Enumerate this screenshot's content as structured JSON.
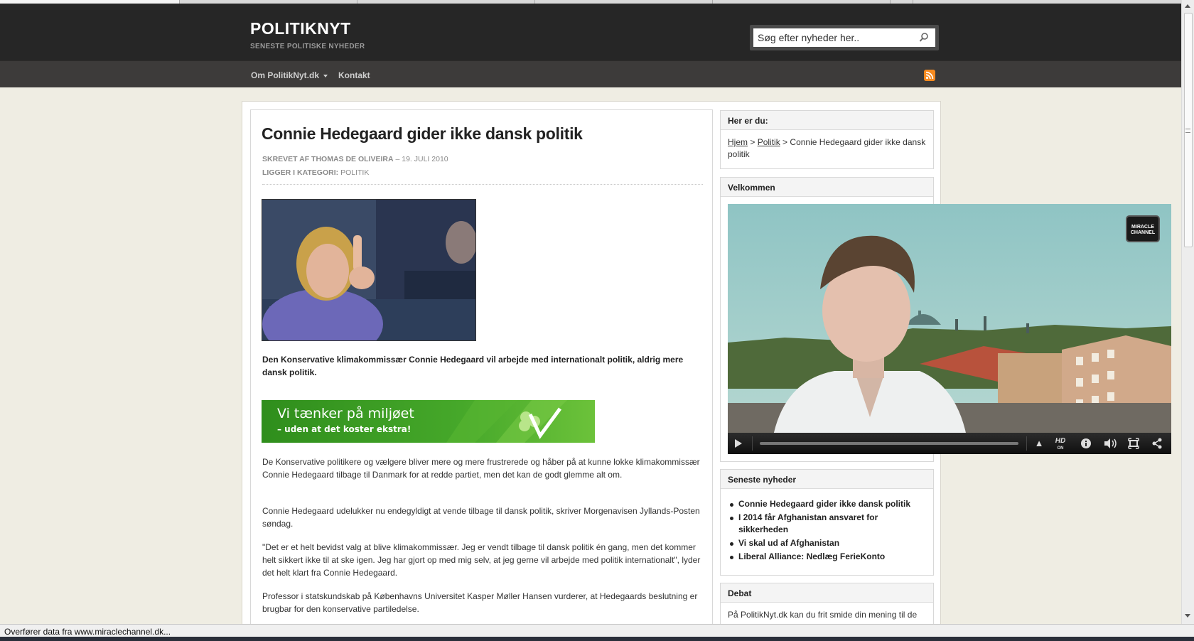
{
  "site": {
    "title": "POLITIKNYT",
    "tagline": "SENESTE POLITISKE NYHEDER"
  },
  "search": {
    "placeholder": "Søg efter nyheder her.."
  },
  "nav": {
    "items": [
      {
        "label": "Om PolitikNyt.dk"
      },
      {
        "label": "Kontakt"
      }
    ]
  },
  "article": {
    "title": "Connie Hedegaard gider ikke dansk politik",
    "author_prefix": "SKREVET AF",
    "author": "THOMAS DE OLIVEIRA",
    "date": "– 19. JULI 2010",
    "category_prefix": "LIGGER I KATEGORI:",
    "category": "POLITIK",
    "lead": "Den Konservative klimakommissær Connie Hedegaard vil arbejde med internationalt politik, aldrig mere dansk politik.",
    "paragraphs": [
      "De Konservative politikere og vælgere bliver mere og mere frustrerede og håber på at kunne lokke klimakommissær Connie Hedegaard tilbage til Danmark for at redde partiet, men det kan de godt glemme alt om.",
      "Connie Hedegaard udelukker nu endegyldigt at vende tilbage til dansk politik, skriver Morgenavisen Jyllands-Posten søndag.",
      "\"Det er et helt bevidst valg at blive klimakommissær. Jeg er vendt tilbage til dansk politik én gang, men det kommer helt sikkert ikke til at ske igen. Jeg har gjort op med mig selv, at jeg gerne vil arbejde med politik internationalt\", lyder det helt klart fra Connie Hedegaard.",
      "Professor i statskundskab på Københavns Universitet Kasper Møller Hansen vurderer, at Hedegaards beslutning er brugbar for den konservative partiledelse."
    ]
  },
  "ad": {
    "line1": "Vi tænker på miljøet",
    "line2": "– uden at det koster ekstra!"
  },
  "sidebar": {
    "breadcrumb": {
      "heading": "Her er du:",
      "home": "Hjem",
      "sep1": " > ",
      "section": "Politik",
      "sep2": " > ",
      "current": "Connie Hedegaard gider ikke dansk politik"
    },
    "welcome": {
      "heading": "Velkommen"
    },
    "latest": {
      "heading": "Seneste nyheder",
      "items": [
        "Connie Hedegaard gider ikke dansk politik",
        "I 2014 får Afghanistan ansvaret for sikkerheden",
        "Vi skal ud af Afghanistan",
        "Liberal Alliance: Nedlæg FerieKonto"
      ]
    },
    "debate": {
      "heading": "Debat",
      "text": "På PolitikNyt.dk kan du frit smide din mening til de"
    }
  },
  "video": {
    "channel_logo": "MIRACLE CHANNEL",
    "hd_label": "HD",
    "hd_state": "ON"
  },
  "status": {
    "text": "Overfører data fra www.miraclechannel.dk..."
  },
  "colors": {
    "header_bg": "#262626",
    "nav_bg": "#3d3b3a",
    "page_bg": "#efede3",
    "rss": "#f68a1f",
    "ad_green": "#3d9a22"
  }
}
